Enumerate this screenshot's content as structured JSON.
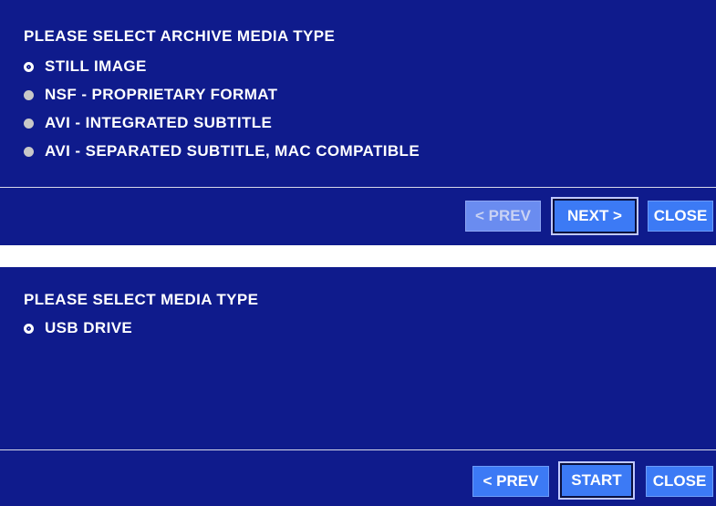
{
  "panel_archive": {
    "title": "PLEASE SELECT ARCHIVE MEDIA TYPE",
    "options": [
      {
        "label": "STILL IMAGE",
        "selected": true
      },
      {
        "label": "NSF - PROPRIETARY FORMAT",
        "selected": false
      },
      {
        "label": "AVI - INTEGRATED SUBTITLE",
        "selected": false
      },
      {
        "label": "AVI - SEPARATED SUBTITLE, MAC COMPATIBLE",
        "selected": false
      }
    ],
    "buttons": {
      "prev": "< PREV",
      "next": "NEXT >",
      "close": "CLOSE"
    }
  },
  "panel_media": {
    "title": "PLEASE SELECT MEDIA TYPE",
    "options": [
      {
        "label": "USB DRIVE",
        "selected": true
      }
    ],
    "buttons": {
      "prev": "< PREV",
      "start": "START",
      "close": "CLOSE"
    }
  },
  "colors": {
    "panel_bg": "#0f1b8c",
    "button_bg": "#3c7af5",
    "button_disabled_bg": "#6a8cf0"
  }
}
